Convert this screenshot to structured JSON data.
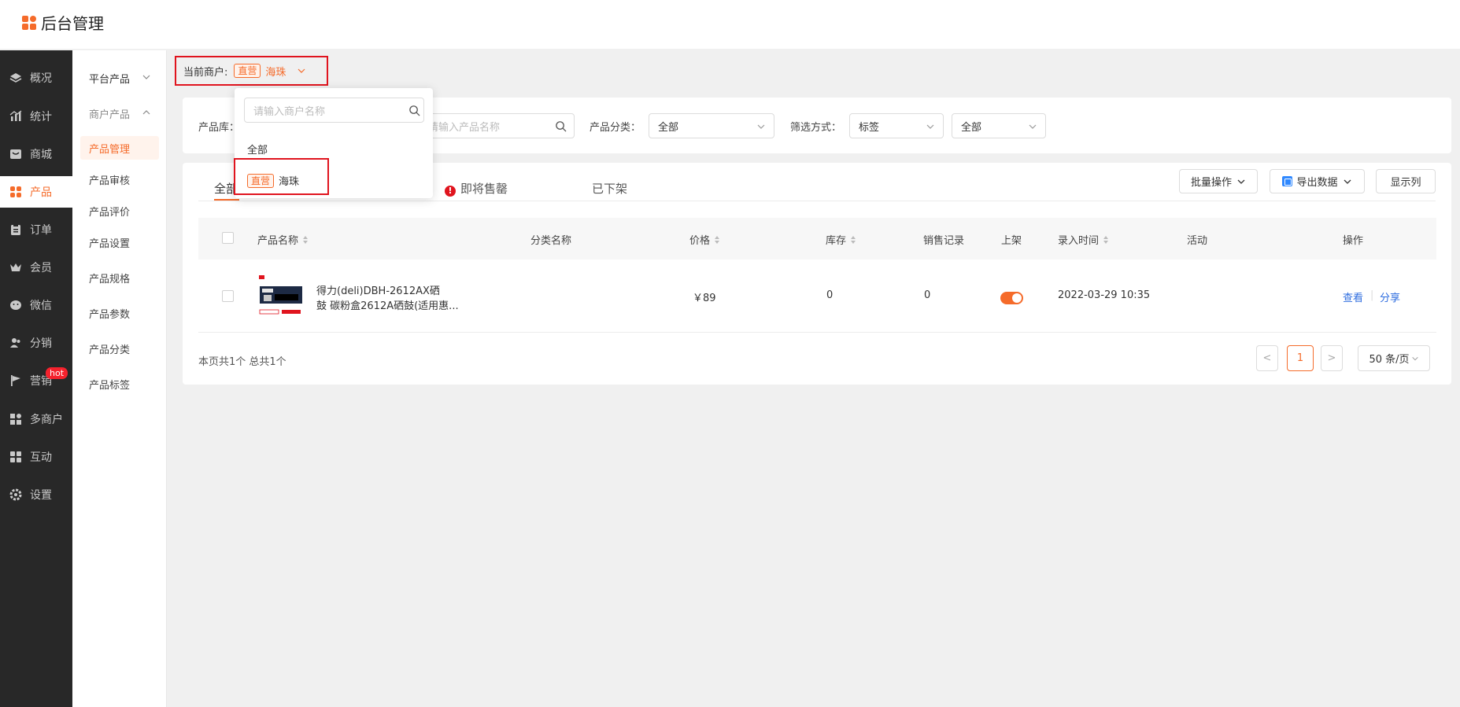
{
  "app": {
    "title": "后台管理"
  },
  "colors": {
    "accent": "#f56b2a",
    "sidebar_bg": "#282828",
    "highlight_frame": "#e0141e",
    "link": "#2d6cdf"
  },
  "sidebar_primary": [
    {
      "label": "概况",
      "icon": "layers-icon"
    },
    {
      "label": "统计",
      "icon": "chart-icon"
    },
    {
      "label": "商城",
      "icon": "store-icon"
    },
    {
      "label": "产品",
      "icon": "grid-icon",
      "active": true
    },
    {
      "label": "订单",
      "icon": "clipboard-icon"
    },
    {
      "label": "会员",
      "icon": "crown-icon"
    },
    {
      "label": "微信",
      "icon": "wechat-icon"
    },
    {
      "label": "分销",
      "icon": "users-icon"
    },
    {
      "label": "营销",
      "icon": "flag-icon",
      "badge": "hot"
    },
    {
      "label": "多商户",
      "icon": "shop-icon"
    },
    {
      "label": "互动",
      "icon": "apps-icon"
    },
    {
      "label": "设置",
      "icon": "gear-icon"
    }
  ],
  "sidebar_secondary": {
    "group1": "平台产品",
    "group2": "商户产品",
    "items": [
      "产品管理",
      "产品审核",
      "产品评价",
      "产品设置",
      "产品规格",
      "产品参数",
      "产品分类",
      "产品标签"
    ]
  },
  "merchant": {
    "label": "当前商户:",
    "tag": "直营",
    "name": "海珠"
  },
  "filters": {
    "library_label": "产品库：",
    "search_placeholder": "请输入产品名称",
    "category_label": "产品分类：",
    "category_value": "全部",
    "filter_label": "筛选方式：",
    "filter_value": "标签",
    "filter_value2": "全部"
  },
  "tabs": {
    "all": "全部",
    "soon_sold_out": "即将售罄",
    "off_shelf": "已下架"
  },
  "toolbar": {
    "batch": "批量操作",
    "export": "导出数据",
    "columns": "显示列"
  },
  "table": {
    "headers": [
      "产品名称",
      "分类名称",
      "价格",
      "库存",
      "销售记录",
      "上架",
      "录入时间",
      "活动",
      "操作"
    ],
    "rows": [
      {
        "name_line1": "得力(deli)DBH-2612AX硒",
        "name_line2": "鼓 碳粉盒2612A硒鼓(适用惠...",
        "category": "",
        "price": "￥89",
        "stock": "0",
        "sales": "0",
        "on_shelf": true,
        "created": "2022-03-29 10:35",
        "activity": "",
        "action_view": "查看",
        "action_share": "分享"
      }
    ]
  },
  "pagination": {
    "summary": "本页共1个 总共1个",
    "current": "1",
    "page_size": "50 条/页",
    "prev": "<",
    "next": ">"
  },
  "dropdown": {
    "search_placeholder": "请输入商户名称",
    "option_all": "全部",
    "option_tag": "直营",
    "option_name": "海珠"
  }
}
